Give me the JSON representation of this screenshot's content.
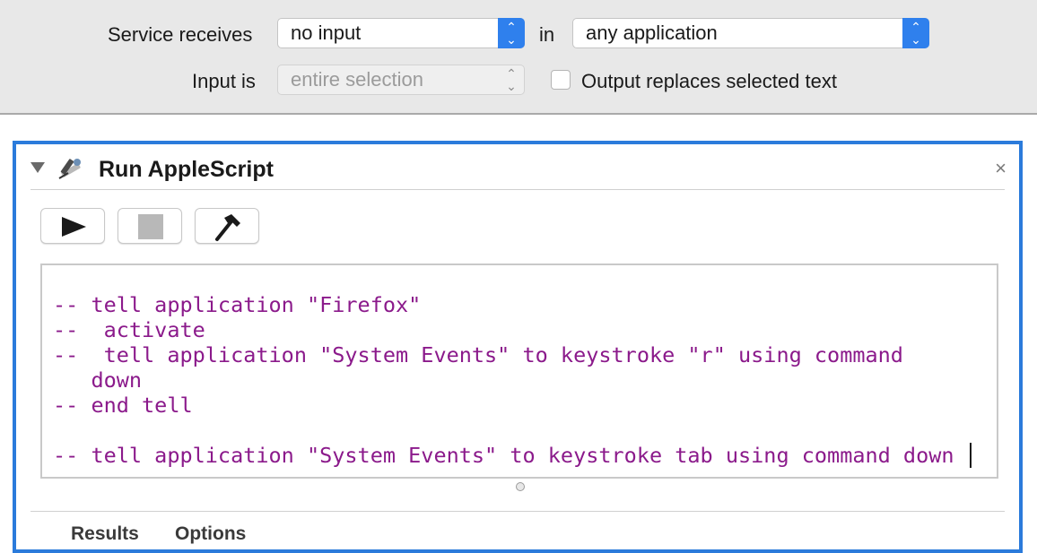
{
  "service": {
    "receives_label": "Service receives",
    "receives_value": "no input",
    "in_label": "in",
    "application_value": "any application",
    "input_is_label": "Input is",
    "input_is_value": "entire selection",
    "output_replaces_label": "Output replaces selected text",
    "output_replaces_checked": false
  },
  "action": {
    "title": "Run AppleScript",
    "close_glyph": "×",
    "toolbar": {
      "run_icon": "play-icon",
      "stop_icon": "stop-icon",
      "compile_icon": "hammer-icon"
    },
    "script_lines": [
      "-- tell application \"Firefox\"",
      "--  activate",
      "--  tell application \"System Events\" to keystroke \"r\" using command",
      "   down",
      "-- end tell",
      "",
      "-- tell application \"System Events\" to keystroke tab using command down"
    ],
    "tabs": [
      "Results",
      "Options"
    ]
  },
  "colors": {
    "accent": "#2b7bdb",
    "script_text": "#8b1a8b",
    "select_arrow": "#2f80ed"
  }
}
